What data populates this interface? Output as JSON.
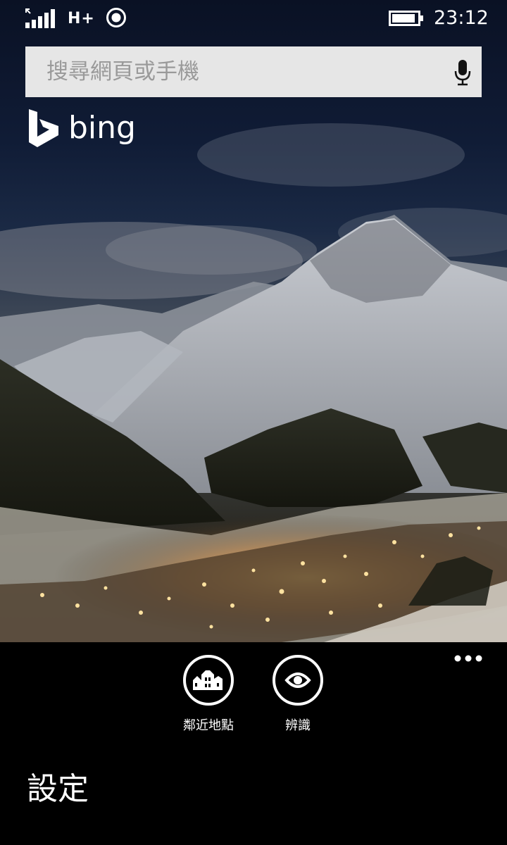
{
  "status_bar": {
    "network_type": "H+",
    "time": "23:12",
    "icons": [
      "signal-strength-icon",
      "sync-icon",
      "battery-icon"
    ]
  },
  "search": {
    "placeholder": "搜尋網頁或手機",
    "value": ""
  },
  "brand": {
    "wordmark": "bing",
    "icon": "bing-logo-icon"
  },
  "actions": [
    {
      "label": "鄰近地點",
      "icon": "nearby-places-icon"
    },
    {
      "label": "辨識",
      "icon": "eye-icon"
    }
  ],
  "menu": {
    "more_icon": "more-dots-icon",
    "settings_label": "設定"
  },
  "colors": {
    "search_background": "#e6e6e6",
    "appbar_background": "#000000",
    "foreground": "#ffffff"
  }
}
